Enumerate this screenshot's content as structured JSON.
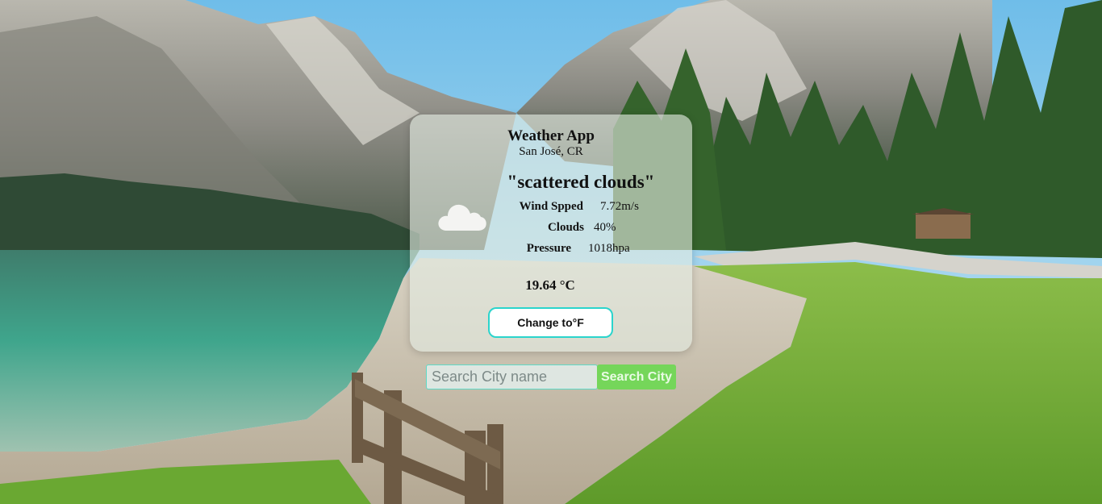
{
  "app": {
    "title": "Weather App",
    "location": "San José, CR"
  },
  "weather": {
    "description": "\"scattered clouds\"",
    "icon": "cloud-icon",
    "stats": [
      {
        "label": "Wind Spped",
        "value": "7.72m/s"
      },
      {
        "label": "Clouds",
        "value": "40%"
      },
      {
        "label": "Pressure",
        "value": "1018hpa"
      }
    ],
    "temperature": "19.64 °C"
  },
  "controls": {
    "toggle_label": "Change to°F",
    "search_placeholder": "Search City name",
    "search_value": "",
    "search_button_label": "Search City"
  },
  "colors": {
    "toggle_border": "#2bd4cc",
    "search_button_bg": "#75d65a",
    "search_input_border": "#5fd9c6",
    "card_bg": "rgba(228,236,226,0.62)"
  }
}
